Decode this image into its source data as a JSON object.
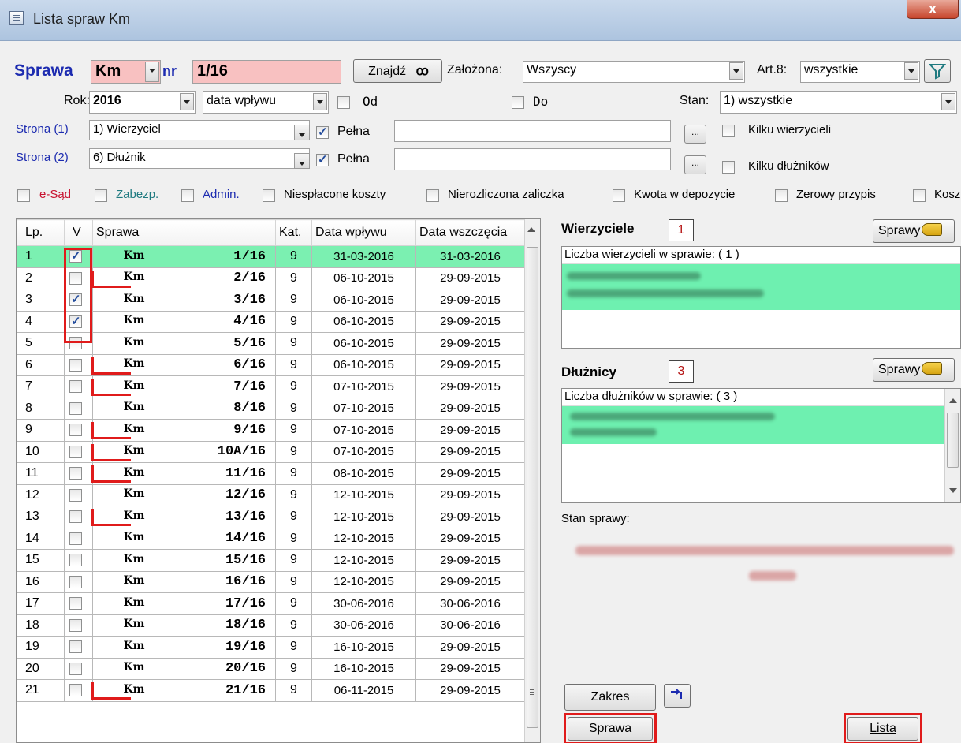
{
  "window": {
    "title": "Lista spraw Km",
    "close": "x"
  },
  "search": {
    "sprawa_label": "Sprawa",
    "repertorium": "Km",
    "nr_label": "nr",
    "nr_value": "1/16",
    "find_button": "Znajdź",
    "zalozona_label": "Założona:",
    "zalozona_value": "Wszyscy",
    "art8_label": "Art.8:",
    "art8_value": "wszystkie",
    "rok_label": "Rok:",
    "rok_value": "2016",
    "date_kind": "data wpływu",
    "od_label": "Od",
    "do_label": "Do",
    "stan_label": "Stan:",
    "stan_value": "1) wszystkie"
  },
  "parties": {
    "strona1_label": "Strona (1)",
    "strona1_value": "1) Wierzyciel",
    "strona2_label": "Strona (2)",
    "strona2_value": "6) Dłużnik",
    "pelna_label": "Pełna",
    "browse_label": "...",
    "kilku_wierzycieli": "Kilku wierzycieli",
    "kilku_dluznikow": "Kilku dłużników"
  },
  "filters": {
    "esad": "e-Sąd",
    "zabezp": "Zabezp.",
    "admin": "Admin.",
    "niesplacone": "Niespłacone koszty",
    "nierozliczona": "Nierozliczona zaliczka",
    "kwota": "Kwota w  depozycie",
    "zerowy": "Zerowy przypis",
    "kosz": "Kosz"
  },
  "colors": {
    "esad": "#c8102e",
    "zabezp": "#1f7a80",
    "admin": "#1c2bb0",
    "strona": "#1c2bb0",
    "selected_row": "#7bf0b1",
    "annotation": "#e01b1b"
  },
  "table": {
    "headers": [
      "Lp.",
      "V",
      "Sprawa",
      "Kat.",
      "Data wpływu",
      "Data wszczęcia"
    ],
    "rows": [
      {
        "lp": "1",
        "checked": true,
        "rep": "Km",
        "nr": "1/16",
        "kat": "9",
        "wplyw": "31-03-2016",
        "wszczecie": "31-03-2016",
        "selected": true
      },
      {
        "lp": "2",
        "checked": false,
        "rep": "Km",
        "nr": "2/16",
        "kat": "9",
        "wplyw": "06-10-2015",
        "wszczecie": "29-09-2015"
      },
      {
        "lp": "3",
        "checked": true,
        "rep": "Km",
        "nr": "3/16",
        "kat": "9",
        "wplyw": "06-10-2015",
        "wszczecie": "29-09-2015"
      },
      {
        "lp": "4",
        "checked": true,
        "rep": "Km",
        "nr": "4/16",
        "kat": "9",
        "wplyw": "06-10-2015",
        "wszczecie": "29-09-2015"
      },
      {
        "lp": "5",
        "checked": false,
        "rep": "Km",
        "nr": "5/16",
        "kat": "9",
        "wplyw": "06-10-2015",
        "wszczecie": "29-09-2015"
      },
      {
        "lp": "6",
        "checked": false,
        "rep": "Km",
        "nr": "6/16",
        "kat": "9",
        "wplyw": "06-10-2015",
        "wszczecie": "29-09-2015"
      },
      {
        "lp": "7",
        "checked": false,
        "rep": "Km",
        "nr": "7/16",
        "kat": "9",
        "wplyw": "07-10-2015",
        "wszczecie": "29-09-2015"
      },
      {
        "lp": "8",
        "checked": false,
        "rep": "Km",
        "nr": "8/16",
        "kat": "9",
        "wplyw": "07-10-2015",
        "wszczecie": "29-09-2015"
      },
      {
        "lp": "9",
        "checked": false,
        "rep": "Km",
        "nr": "9/16",
        "kat": "9",
        "wplyw": "07-10-2015",
        "wszczecie": "29-09-2015"
      },
      {
        "lp": "10",
        "checked": false,
        "rep": "Km",
        "nr": "10A/16",
        "kat": "9",
        "wplyw": "07-10-2015",
        "wszczecie": "29-09-2015"
      },
      {
        "lp": "11",
        "checked": false,
        "rep": "Km",
        "nr": "11/16",
        "kat": "9",
        "wplyw": "08-10-2015",
        "wszczecie": "29-09-2015"
      },
      {
        "lp": "12",
        "checked": false,
        "rep": "Km",
        "nr": "12/16",
        "kat": "9",
        "wplyw": "12-10-2015",
        "wszczecie": "29-09-2015"
      },
      {
        "lp": "13",
        "checked": false,
        "rep": "Km",
        "nr": "13/16",
        "kat": "9",
        "wplyw": "12-10-2015",
        "wszczecie": "29-09-2015"
      },
      {
        "lp": "14",
        "checked": false,
        "rep": "Km",
        "nr": "14/16",
        "kat": "9",
        "wplyw": "12-10-2015",
        "wszczecie": "29-09-2015"
      },
      {
        "lp": "15",
        "checked": false,
        "rep": "Km",
        "nr": "15/16",
        "kat": "9",
        "wplyw": "12-10-2015",
        "wszczecie": "29-09-2015"
      },
      {
        "lp": "16",
        "checked": false,
        "rep": "Km",
        "nr": "16/16",
        "kat": "9",
        "wplyw": "12-10-2015",
        "wszczecie": "29-09-2015"
      },
      {
        "lp": "17",
        "checked": false,
        "rep": "Km",
        "nr": "17/16",
        "kat": "9",
        "wplyw": "30-06-2016",
        "wszczecie": "30-06-2016"
      },
      {
        "lp": "18",
        "checked": false,
        "rep": "Km",
        "nr": "18/16",
        "kat": "9",
        "wplyw": "30-06-2016",
        "wszczecie": "30-06-2016"
      },
      {
        "lp": "19",
        "checked": false,
        "rep": "Km",
        "nr": "19/16",
        "kat": "9",
        "wplyw": "16-10-2015",
        "wszczecie": "29-09-2015"
      },
      {
        "lp": "20",
        "checked": false,
        "rep": "Km",
        "nr": "20/16",
        "kat": "9",
        "wplyw": "16-10-2015",
        "wszczecie": "29-09-2015"
      },
      {
        "lp": "21",
        "checked": false,
        "rep": "Km",
        "nr": "21/16",
        "kat": "9",
        "wplyw": "06-11-2015",
        "wszczecie": "29-09-2015"
      }
    ]
  },
  "creditors": {
    "title": "Wierzyciele",
    "count": "1",
    "button": "Sprawy",
    "caption": "Liczba wierzycieli w sprawie: (    1    )"
  },
  "debtors": {
    "title": "Dłużnicy",
    "count": "3",
    "button": "Sprawy",
    "caption": "Liczba dłużników w sprawie: (   3   )"
  },
  "status": {
    "label": "Stan sprawy:"
  },
  "actions": {
    "zakres": "Zakres",
    "sprawa": "Sprawa",
    "lista": "Lista"
  }
}
